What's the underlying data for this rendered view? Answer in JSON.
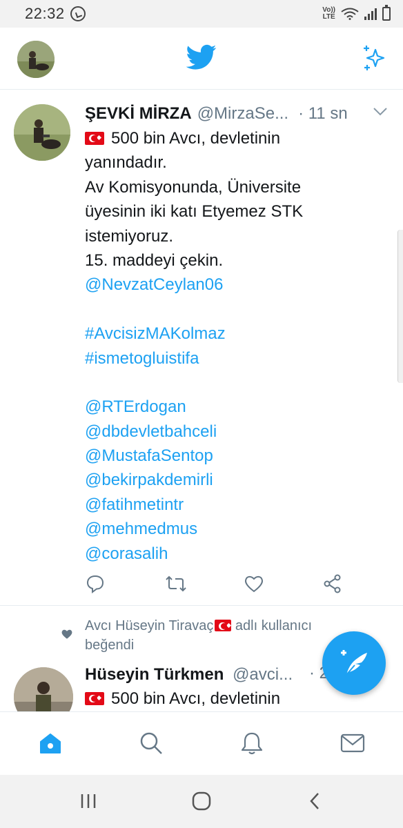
{
  "status_bar": {
    "time": "22:32",
    "network_top": "Vo))",
    "network_bottom": "LTE",
    "icons": [
      "whatsapp-icon",
      "wifi-icon",
      "signal-icon",
      "battery-icon"
    ]
  },
  "header": {
    "logo": "twitter-bird-icon",
    "sparkle": "sparkle-icon"
  },
  "tweet": {
    "name": "ŞEVKİ MİRZA",
    "handle": "@MirzaSe...",
    "time": "· 11 sn",
    "lines": [
      {
        "flag": true,
        "text": "500 bin Avcı, devletinin",
        "link": false
      },
      {
        "flag": false,
        "text": "yanındadır.",
        "link": false
      },
      {
        "flag": false,
        "text": "Av Komisyonunda, Üniversite",
        "link": false
      },
      {
        "flag": false,
        "text": "üyesinin iki katı Etyemez STK",
        "link": false
      },
      {
        "flag": false,
        "text": "istemiyoruz.",
        "link": false
      },
      {
        "flag": false,
        "text": "15. maddeyi çekin.",
        "link": false
      },
      {
        "flag": false,
        "text": "@NevzatCeylan06",
        "link": true
      },
      {
        "flag": false,
        "text": "",
        "link": false
      },
      {
        "flag": false,
        "text": "#AvcisizMAKolmaz",
        "link": true
      },
      {
        "flag": false,
        "text": "#ismetogluistifa",
        "link": true
      },
      {
        "flag": false,
        "text": "",
        "link": false
      },
      {
        "flag": false,
        "text": "@RTErdogan",
        "link": true
      },
      {
        "flag": false,
        "text": "@dbdevletbahceli",
        "link": true
      },
      {
        "flag": false,
        "text": "@MustafaSentop",
        "link": true
      },
      {
        "flag": false,
        "text": "@bekirpakdemirli",
        "link": true
      },
      {
        "flag": false,
        "text": "@fatihmetintr",
        "link": true
      },
      {
        "flag": false,
        "text": "@mehmedmus",
        "link": true
      },
      {
        "flag": false,
        "text": "@corasalih",
        "link": true
      }
    ],
    "actions": [
      "reply-icon",
      "retweet-icon",
      "like-icon",
      "share-icon"
    ]
  },
  "liked": {
    "text_before": "Avcı Hüseyin Tiravaç",
    "text_after": " adlı kullanıcı",
    "text_line2": "beğendi"
  },
  "tweet2": {
    "name": "Hüseyin Türkmen",
    "handle": "@avci...",
    "time": "· 2",
    "body": "500 bin Avcı, devletinin"
  },
  "colors": {
    "accent": "#1da1f2",
    "text": "#14171a",
    "muted": "#657786",
    "flag": "#e30a17"
  }
}
